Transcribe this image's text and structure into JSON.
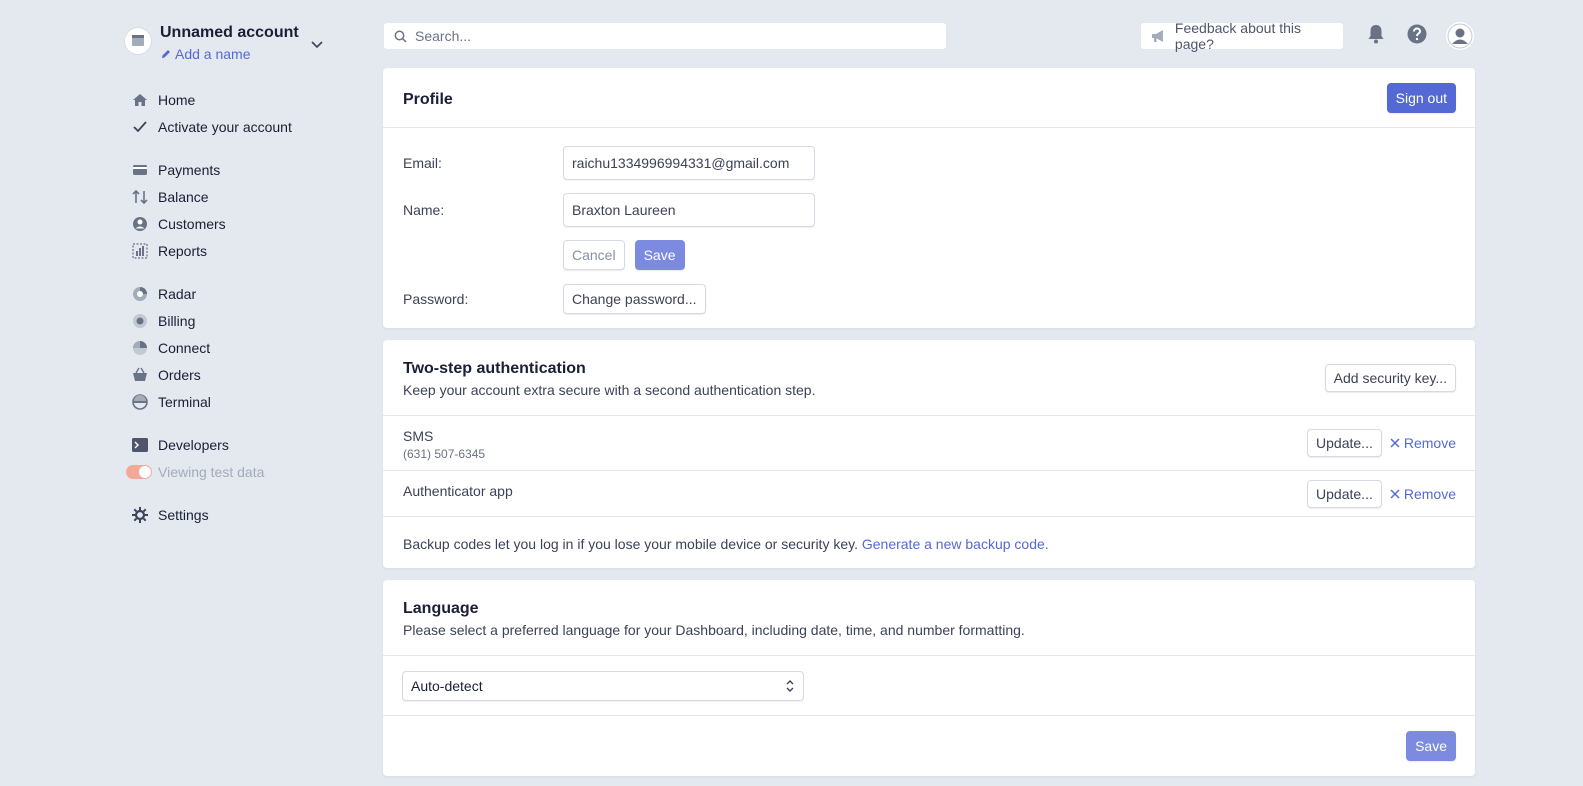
{
  "account": {
    "name": "Unnamed account",
    "add_name": "Add a name"
  },
  "nav": {
    "groups": [
      [
        {
          "label": "Home",
          "icon": "home-icon"
        },
        {
          "label": "Activate your account",
          "icon": "check-icon"
        }
      ],
      [
        {
          "label": "Payments",
          "icon": "payments-icon"
        },
        {
          "label": "Balance",
          "icon": "balance-icon"
        },
        {
          "label": "Customers",
          "icon": "customers-icon"
        },
        {
          "label": "Reports",
          "icon": "reports-icon"
        }
      ],
      [
        {
          "label": "Radar",
          "icon": "radar-icon"
        },
        {
          "label": "Billing",
          "icon": "billing-icon"
        },
        {
          "label": "Connect",
          "icon": "connect-icon"
        },
        {
          "label": "Orders",
          "icon": "orders-icon"
        },
        {
          "label": "Terminal",
          "icon": "terminal-icon"
        }
      ],
      [
        {
          "label": "Developers",
          "icon": "developers-icon"
        },
        {
          "label": "Viewing test data",
          "icon": "toggle"
        }
      ],
      [
        {
          "label": "Settings",
          "icon": "gear-icon"
        }
      ]
    ]
  },
  "topbar": {
    "search_placeholder": "Search...",
    "feedback": "Feedback about this page?"
  },
  "profile": {
    "title": "Profile",
    "sign_out": "Sign out",
    "email_label": "Email:",
    "email_value": "raichu1334996994331@gmail.com",
    "name_label": "Name:",
    "name_value": "Braxton Laureen",
    "cancel": "Cancel",
    "save": "Save",
    "password_label": "Password:",
    "change_password": "Change password..."
  },
  "tfa": {
    "title": "Two-step authentication",
    "subtitle": "Keep your account extra secure with a second authentication step.",
    "add_key": "Add security key...",
    "sms_title": "SMS",
    "sms_phone": "(631) 507-6345",
    "app_title": "Authenticator app",
    "update": "Update...",
    "remove": "Remove",
    "backup_text": "Backup codes let you log in if you lose your mobile device or security key.",
    "backup_link": "Generate a new backup code."
  },
  "language": {
    "title": "Language",
    "subtitle": "Please select a preferred language for your Dashboard, including date, time, and number formatting.",
    "selected": "Auto-detect",
    "save": "Save"
  },
  "colors": {
    "accent": "#5469d4",
    "background": "#e4e8ef",
    "toggle": "#f3a99a"
  }
}
